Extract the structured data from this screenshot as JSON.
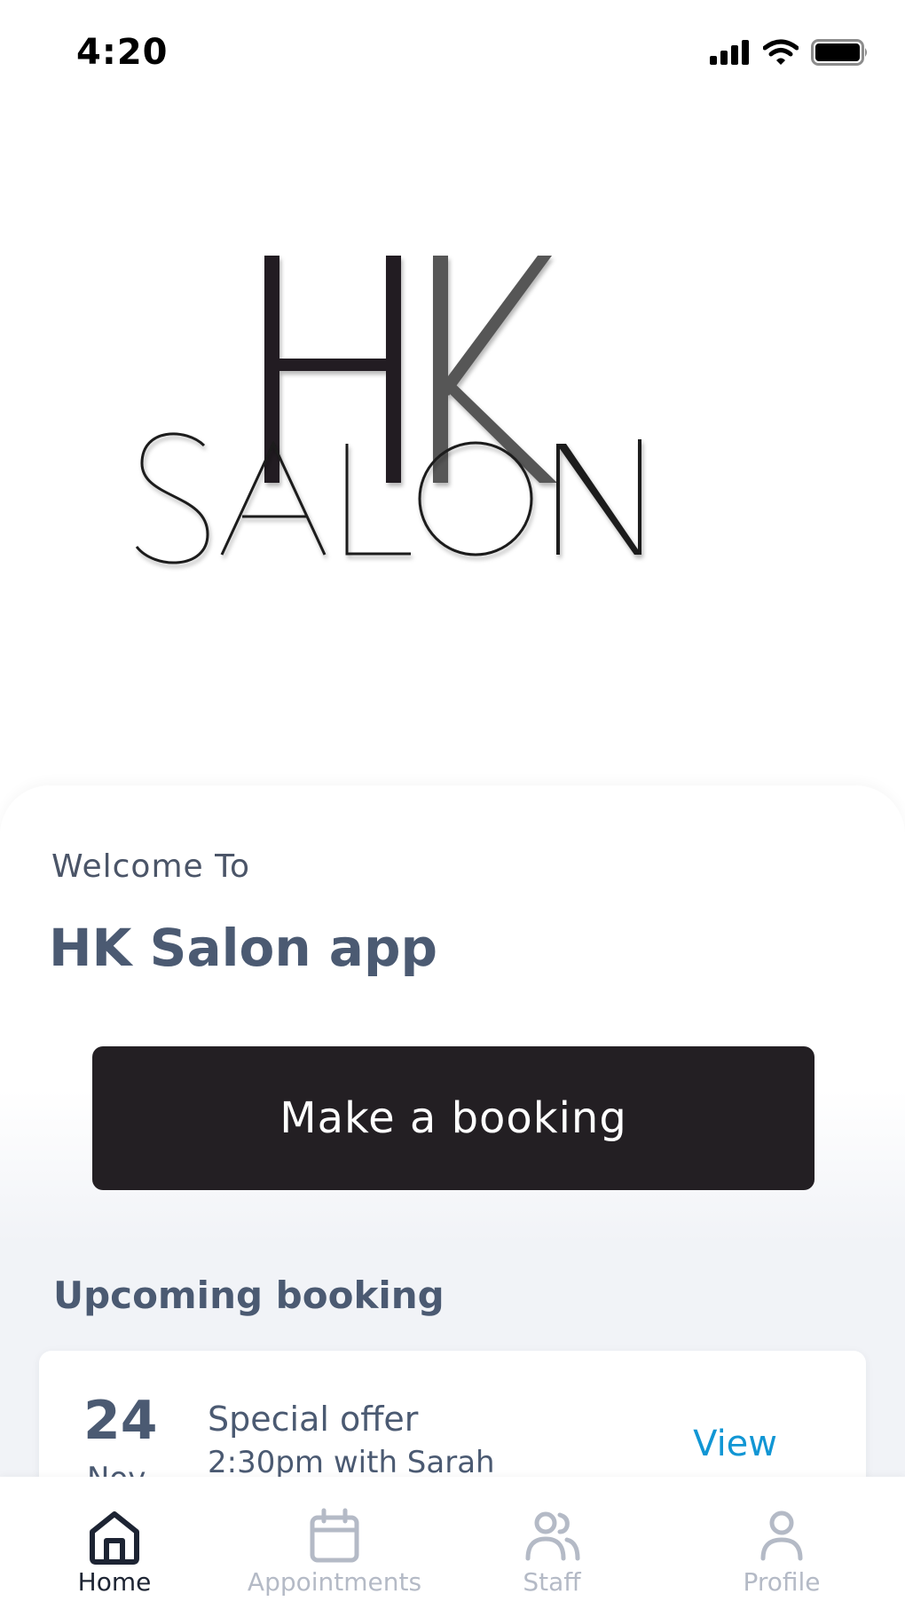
{
  "status_bar": {
    "time": "4:20",
    "icons": [
      "cellular-signal-icon",
      "wifi-icon",
      "battery-icon"
    ]
  },
  "logo": {
    "line1": "HK",
    "line2": "SALON"
  },
  "welcome": {
    "label": "Welcome To",
    "title": "HK Salon app"
  },
  "primary_action": {
    "label": "Make a booking"
  },
  "upcoming": {
    "section_title": "Upcoming booking",
    "card": {
      "day": "24",
      "month": "Nov",
      "title": "Special offer",
      "subtitle": "2:30pm with Sarah",
      "action_label": "View"
    }
  },
  "tab_bar": {
    "items": [
      {
        "label": "Home",
        "icon": "home-icon",
        "active": true
      },
      {
        "label": "Appointments",
        "icon": "calendar-icon",
        "active": false
      },
      {
        "label": "Staff",
        "icon": "users-icon",
        "active": false
      },
      {
        "label": "Profile",
        "icon": "profile-icon",
        "active": false
      }
    ]
  },
  "colors": {
    "button_bg": "#231f23",
    "heading_text": "#4b5a72",
    "link": "#1196d4",
    "tab_inactive": "#b4bac6",
    "tab_active": "#1d2433"
  }
}
